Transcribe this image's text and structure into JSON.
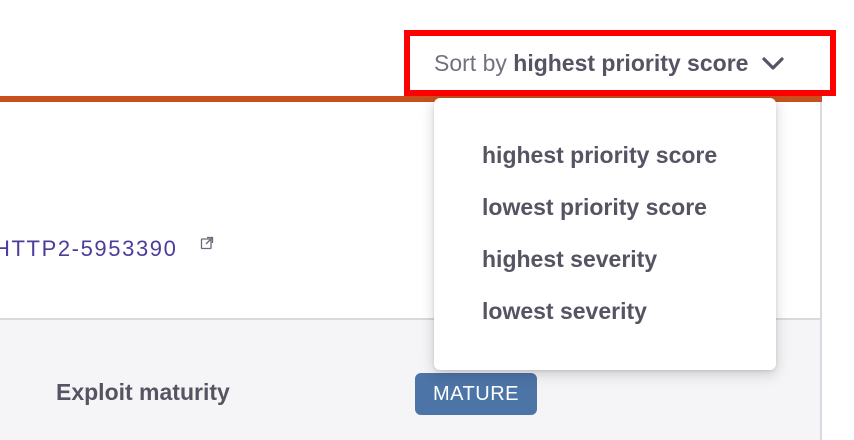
{
  "sort": {
    "prefix": "Sort by",
    "selected": "highest priority score",
    "options": [
      "highest priority score",
      "lowest priority score",
      "highest severity",
      "lowest severity"
    ]
  },
  "issue": {
    "id_link": "HTTP2-5953390",
    "detail_label": "Exploit maturity",
    "badge": "MATURE"
  },
  "colors": {
    "accent_bar": "#c9501e",
    "highlight_border": "#ff0000",
    "badge_bg": "#4d74a6",
    "link": "#4a3d9c"
  },
  "icons": {
    "sort_toggle": "chevron-down-icon",
    "link_external": "external-link-icon"
  }
}
